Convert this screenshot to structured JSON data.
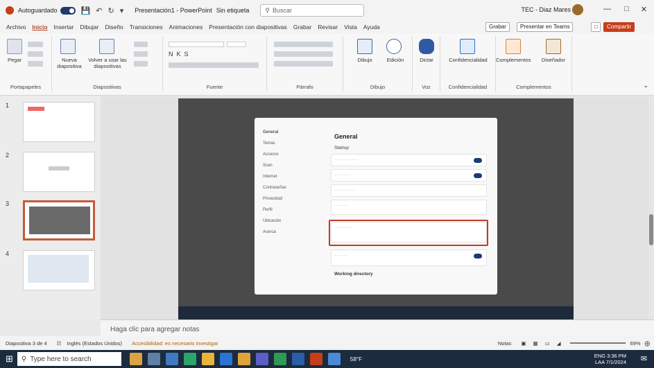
{
  "titlebar": {
    "autosave_label": "Autoguardado",
    "window_title": "Presentación1 - PowerPoint",
    "sensitivity": "Sin etiqueta",
    "search_placeholder": "Buscar",
    "user": "TEC - Diaz Mares"
  },
  "tabs": [
    "Archivo",
    "Inicio",
    "Insertar",
    "Dibujar",
    "Diseño",
    "Transiciones",
    "Animaciones",
    "Presentación con diapositivas",
    "Grabar",
    "Revisar",
    "Vista",
    "Ayuda"
  ],
  "active_tab": "Inicio",
  "ribbon_buttons": {
    "record": "Grabar",
    "present_teams": "Presentar en Teams",
    "share": "Compartir"
  },
  "ribbon_groups": [
    "Portapapeles",
    "Diapositivas",
    "Fuente",
    "Párrafo",
    "Dibujo",
    "Edición",
    "Voz",
    "Confidencialidad",
    "Complementos"
  ],
  "ribbon_big": {
    "paste": "Pegar",
    "new_slide": "Nueva diapositiva",
    "reuse": "Volver a usar las diapositivas",
    "draw": "Dibujo",
    "edit": "Edición",
    "dictate": "Dictar",
    "sensitivity": "Confidencialidad",
    "addins": "Complementos",
    "designer": "Diseñador"
  },
  "slides": [
    "1",
    "2",
    "3",
    "4"
  ],
  "selected_slide": "3",
  "dialog": {
    "nav": [
      "General",
      "Temas",
      "Accesos",
      "Scan",
      "Internet",
      "Contraseñas",
      "Privacidad",
      "Perfil",
      "Ubicación",
      "Acerca"
    ],
    "title": "General",
    "section": "Startup",
    "working_directory": "Working directory"
  },
  "notes_placeholder": "Haga clic para agregar notas",
  "status": {
    "slide_info": "Diapositiva 3 de 4",
    "language": "Inglés (Estados Unidos)",
    "accessibility": "Accesibilidad: es necesario investigar",
    "notes_btn": "Notas",
    "zoom": "69%"
  },
  "taskbar": {
    "search_placeholder": "Type here to search",
    "temp": "58°F",
    "lang": "ENG",
    "lang2": "LAA",
    "time": "3:36 PM",
    "date": "7/1/2024"
  },
  "colors": {
    "accent": "#b7472a",
    "share": "#c43e1c",
    "taskbar": "#1c2b3d",
    "highlight": "#c0392b"
  }
}
